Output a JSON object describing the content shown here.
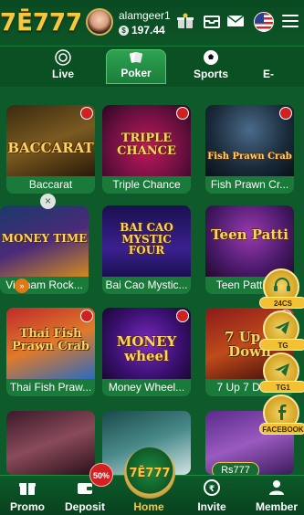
{
  "header": {
    "logo": "7Ē777",
    "username": "alamgeer1",
    "coin_symbol": "$",
    "balance": "197.44"
  },
  "tabs": [
    {
      "label": "Live",
      "icon": "poker-chip-icon"
    },
    {
      "label": "Poker",
      "icon": "cards-icon",
      "active": true
    },
    {
      "label": "Sports",
      "icon": "soccer-ball-icon"
    },
    {
      "label": "E-",
      "icon": "esports-icon"
    }
  ],
  "games": [
    {
      "title": "Baccarat",
      "art_text": "BACCARAT"
    },
    {
      "title": "Triple Chance",
      "art_text": "TRIPLE CHANCE"
    },
    {
      "title": "Fish Prawn Cr...",
      "art_text": "Fish Prawn Crab"
    },
    {
      "title": "Vietnam Rock...",
      "art_text": "MONEY TIME"
    },
    {
      "title": "Bai Cao Mystic...",
      "art_text": "BAI CAO MYSTIC FOUR"
    },
    {
      "title": "Teen Patti V...",
      "art_text": "Teen Patti"
    },
    {
      "title": "Thai Fish Praw...",
      "art_text": "Thai Fish Prawn Crab"
    },
    {
      "title": "Money Wheel...",
      "art_text": "MONEY wheel"
    },
    {
      "title": "7 Up 7 Dow...",
      "art_text": "7 Up 7 Down"
    },
    {
      "title": "",
      "art_text": ""
    },
    {
      "title": "",
      "art_text": ""
    },
    {
      "title": "",
      "art_text": ""
    }
  ],
  "floating": {
    "support_label": "24CS",
    "tg_label": "TG",
    "tg1_label": "TG1",
    "facebook_label": "FACEBOOK",
    "rs_label": "Rs777",
    "discount_label": "50%",
    "home_orb_text": "7Ē777",
    "close_glyph": "×",
    "collapse_glyph": "»"
  },
  "bottom_nav": {
    "promo": "Promo",
    "deposit": "Deposit",
    "home": "Home",
    "invite": "Invite",
    "member": "Member"
  },
  "colors": {
    "background": "#0f5a2a",
    "accent_gold": "#f5c842",
    "card": "#1a7a3a",
    "badge_red": "#d42020"
  }
}
